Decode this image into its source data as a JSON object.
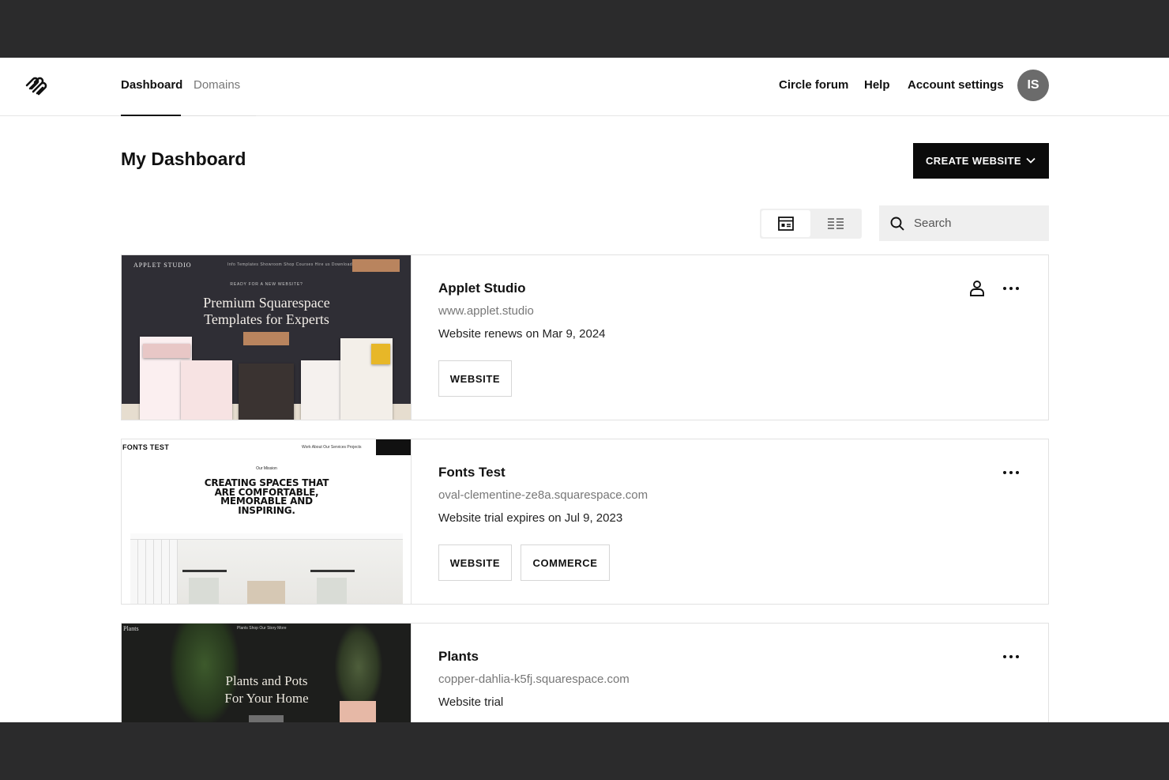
{
  "nav": {
    "tabs": [
      {
        "label": "Dashboard",
        "active": true
      },
      {
        "label": "Domains",
        "active": false
      }
    ],
    "links": [
      "Circle forum",
      "Help",
      "Account settings"
    ],
    "avatar_initials": "IS"
  },
  "page": {
    "title": "My Dashboard",
    "create_label": "CREATE WEBSITE",
    "search_placeholder": "Search"
  },
  "sites": [
    {
      "name": "Applet Studio",
      "url": "www.applet.studio",
      "status": "Website renews on Mar 9, 2024",
      "badges": [
        "WEBSITE"
      ],
      "thumb": {
        "brand": "APPLET STUDIO",
        "links": "Info  Templates  Showroom  Shop  Courses  Hire us  Downloads",
        "kicker": "READY FOR A NEW WEBSITE?",
        "headline_1": "Premium Squarespace",
        "headline_2": "Templates for Experts"
      }
    },
    {
      "name": "Fonts Test",
      "url": "oval-clementine-ze8a.squarespace.com",
      "status": "Website trial expires on Jul 9, 2023",
      "badges": [
        "WEBSITE",
        "COMMERCE"
      ],
      "thumb": {
        "brand": "FONTS TEST",
        "links": "Work  About  Our Services  Projects",
        "kicker": "Our Mission",
        "headline": "CREATING SPACES THAT ARE COMFORTABLE, MEMORABLE AND INSPIRING."
      }
    },
    {
      "name": "Plants",
      "url": "copper-dahlia-k5fj.squarespace.com",
      "status": "Website trial",
      "badges": [],
      "thumb": {
        "brand": "Plants",
        "links": "Plants   Shop   Our Story   More",
        "headline_1": "Plants and Pots",
        "headline_2": "For Your Home"
      }
    }
  ]
}
